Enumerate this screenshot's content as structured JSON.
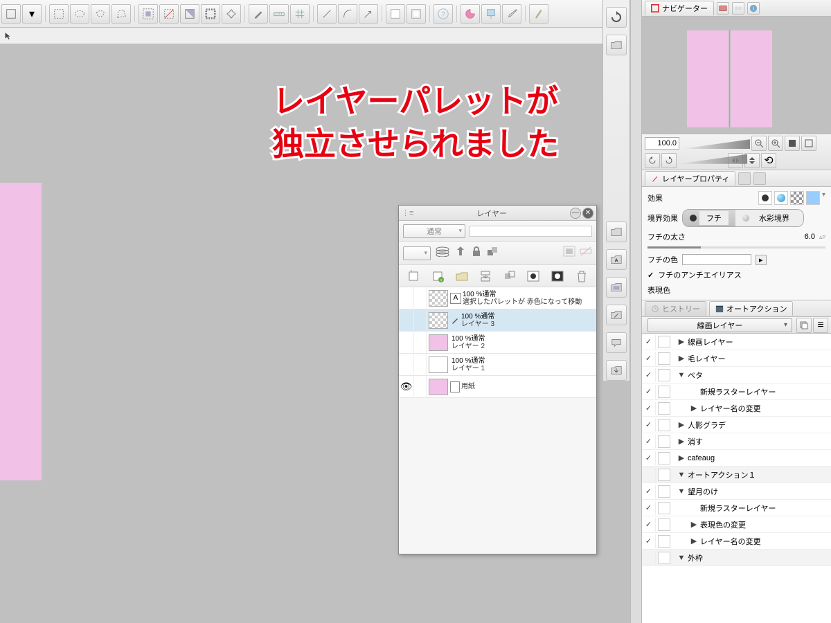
{
  "annotation": {
    "line1": "レイヤーパレットが",
    "line2": "独立させられました"
  },
  "navigator_tab": "ナビゲーター",
  "zoom_value": "100.0",
  "layer_property": {
    "tab": "レイヤープロパティ",
    "effect_label": "効果",
    "boundary_label": "境界効果",
    "border_option": "フチ",
    "watercolor_option": "水彩境界",
    "border_width_label": "フチの太さ",
    "border_width_value": "6.0",
    "border_color_label": "フチの色",
    "antialias_label": "フチのアンチエイリアス",
    "render_color_label": "表現色"
  },
  "history_tab": "ヒストリー",
  "autoaction_tab": "オートアクション",
  "autoaction_selected": "線画レイヤー",
  "autoaction_items": [
    {
      "checked": true,
      "expand": "▶",
      "label": "線画レイヤー",
      "child": false
    },
    {
      "checked": true,
      "expand": "▶",
      "label": "毛レイヤー",
      "child": false
    },
    {
      "checked": true,
      "expand": "▼",
      "label": "ベタ",
      "child": false
    },
    {
      "checked": true,
      "expand": "",
      "label": "新規ラスターレイヤー",
      "child": true
    },
    {
      "checked": true,
      "expand": "▶",
      "label": "レイヤー名の変更",
      "child": true
    },
    {
      "checked": true,
      "expand": "▶",
      "label": "人影グラデ",
      "child": false
    },
    {
      "checked": true,
      "expand": "▶",
      "label": "消す",
      "child": false
    },
    {
      "checked": true,
      "expand": "▶",
      "label": "cafeaug",
      "child": false
    },
    {
      "checked": false,
      "expand": "▼",
      "label": "オートアクション１",
      "child": false,
      "gray": true
    },
    {
      "checked": true,
      "expand": "▼",
      "label": "望月のけ",
      "child": false
    },
    {
      "checked": true,
      "expand": "",
      "label": "新規ラスターレイヤー",
      "child": true
    },
    {
      "checked": true,
      "expand": "▶",
      "label": "表現色の変更",
      "child": true
    },
    {
      "checked": true,
      "expand": "▶",
      "label": "レイヤー名の変更",
      "child": true
    },
    {
      "checked": false,
      "expand": "▼",
      "label": "外枠",
      "child": false,
      "gray": true
    }
  ],
  "layer_panel": {
    "title": "レイヤー",
    "blend_mode": "通常",
    "layers": [
      {
        "eye": false,
        "thumb": "checker",
        "type_icon": "A",
        "opacity": "100 %通常",
        "name": "選択したパレットが 赤色になって移動",
        "sel": false
      },
      {
        "eye": false,
        "thumb": "checker",
        "type_icon": "pen",
        "opacity": "100 %通常",
        "name": "レイヤー 3",
        "sel": true
      },
      {
        "eye": false,
        "thumb": "pink",
        "type_icon": "",
        "opacity": "100 %通常",
        "name": "レイヤー 2",
        "sel": false
      },
      {
        "eye": false,
        "thumb": "white",
        "type_icon": "",
        "opacity": "100 %通常",
        "name": "レイヤー 1",
        "sel": false
      },
      {
        "eye": true,
        "thumb": "pink",
        "type_icon": "paper",
        "opacity": "",
        "name": "用紙",
        "sel": false
      }
    ]
  }
}
